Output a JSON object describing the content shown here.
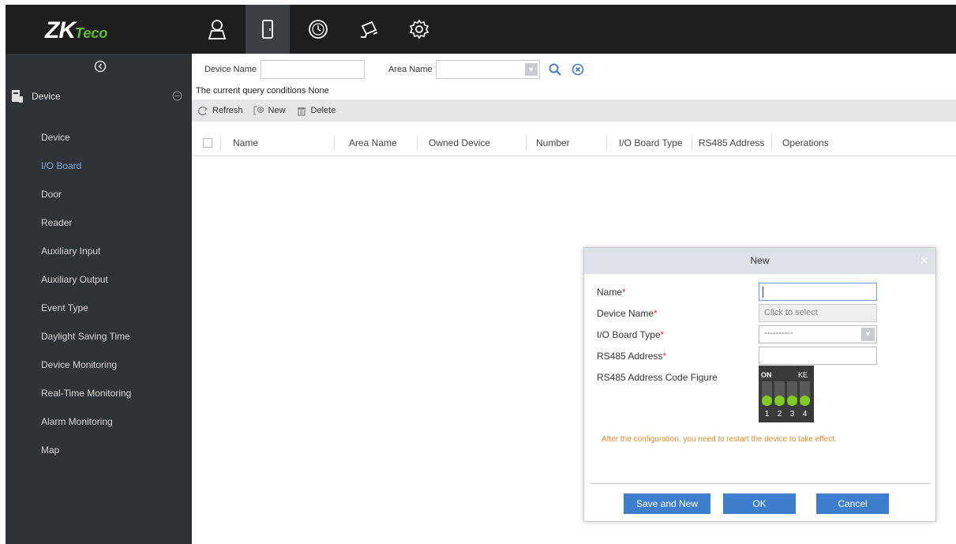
{
  "header": {
    "logo_main": "ZK",
    "logo_sub": "Teco",
    "modules": [
      {
        "name": "person-icon",
        "active": false
      },
      {
        "name": "door-icon",
        "active": true
      },
      {
        "name": "clock-icon",
        "active": false
      },
      {
        "name": "camera-icon",
        "active": false
      },
      {
        "name": "gear-icon",
        "active": false
      }
    ]
  },
  "sidebar": {
    "section_title": "Device",
    "items": [
      {
        "label": "Device",
        "active": false
      },
      {
        "label": "I/O Board",
        "active": true
      },
      {
        "label": "Door",
        "active": false
      },
      {
        "label": "Reader",
        "active": false
      },
      {
        "label": "Auxiliary Input",
        "active": false
      },
      {
        "label": "Auxiliary Output",
        "active": false
      },
      {
        "label": "Event Type",
        "active": false
      },
      {
        "label": "Daylight Saving Time",
        "active": false
      },
      {
        "label": "Device Monitoring",
        "active": false
      },
      {
        "label": "Real-Time Monitoring",
        "active": false
      },
      {
        "label": "Alarm Monitoring",
        "active": false
      },
      {
        "label": "Map",
        "active": false
      }
    ]
  },
  "search": {
    "device_name_label": "Device Name",
    "device_name_value": "",
    "area_name_label": "Area Name",
    "area_name_value": ""
  },
  "query": {
    "text": "The current query conditions None"
  },
  "toolbar": {
    "refresh": "Refresh",
    "new": "New",
    "delete": "Delete"
  },
  "table": {
    "columns": [
      "Name",
      "Area Name",
      "Owned Device",
      "Number",
      "I/O Board Type",
      "RS485 Address",
      "Operations"
    ],
    "rows": []
  },
  "dialog": {
    "title": "New",
    "fields": {
      "name_label": "Name",
      "device_name_label": "Device Name",
      "device_name_placeholder": "Click to select",
      "io_board_type_label": "I/O Board Type",
      "io_board_type_value": "----------",
      "rs485_label": "RS485 Address",
      "rs485_code_label": "RS485 Address Code Figure",
      "required_mark": "*"
    },
    "dip": {
      "on_label": "ON",
      "ke_label": "KE",
      "numbers": [
        "1",
        "2",
        "3",
        "4"
      ]
    },
    "note": "After the configuration, you need to restart the device to take effect.",
    "buttons": {
      "save_new": "Save and New",
      "ok": "OK",
      "cancel": "Cancel"
    }
  },
  "colors": {
    "topbar": "#1e1e1e",
    "sidebar": "#2f3237",
    "active_link": "#7ba7d8",
    "primary_button": "#3d7fcc",
    "note": "#e58a2c",
    "required": "#e03030"
  }
}
